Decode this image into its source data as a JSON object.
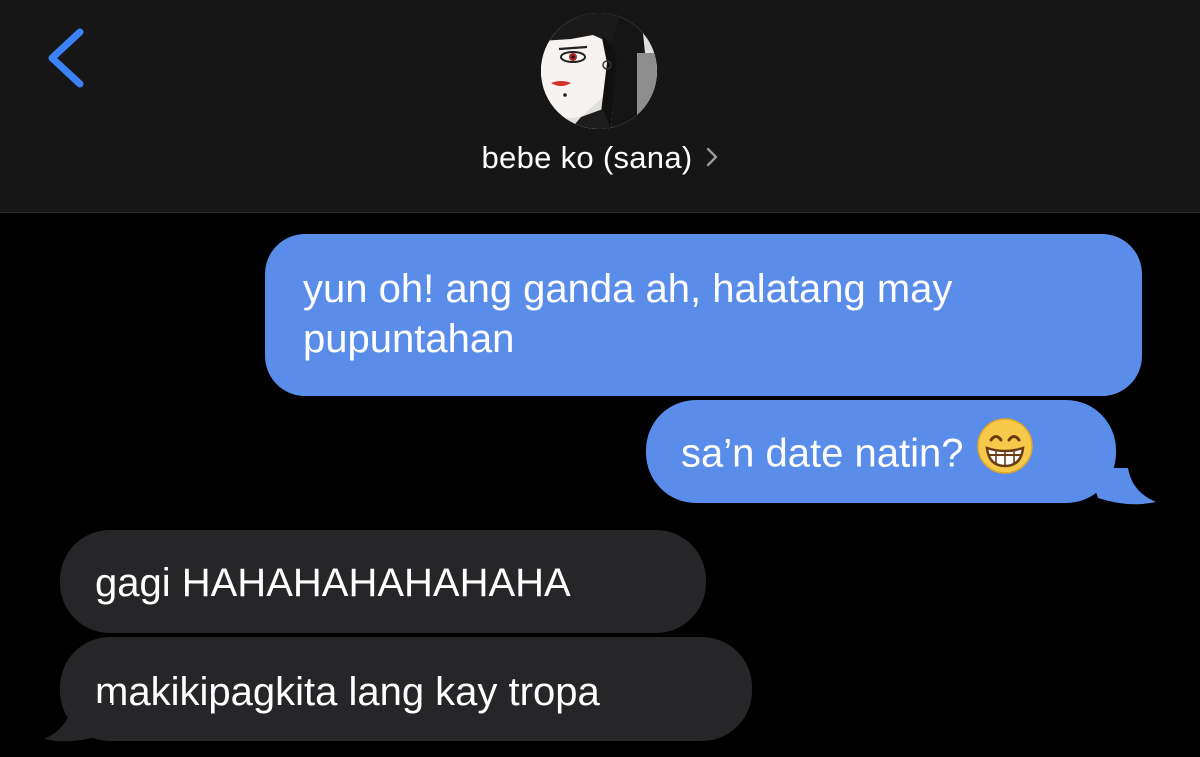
{
  "header": {
    "back_icon": "chevron-left-icon",
    "contact_name": "bebe ko (sana)",
    "details_icon": "chevron-right-icon",
    "avatar": "contact-avatar-illustration"
  },
  "colors": {
    "sent_bubble": "#5a8dea",
    "received_bubble": "#262629",
    "accent": "#3b82f6",
    "background": "#000000",
    "header_background": "#161616"
  },
  "messages": [
    {
      "direction": "sent",
      "text": "yun oh! ang ganda ah, halatang may pupuntahan"
    },
    {
      "direction": "sent",
      "text": "sa’n date natin?",
      "emoji": "grinning-face-with-smiling-eyes"
    },
    {
      "direction": "received",
      "text": "gagi HAHAHAHAHAHAHA"
    },
    {
      "direction": "received",
      "text": "makikipagkita lang kay tropa"
    }
  ]
}
